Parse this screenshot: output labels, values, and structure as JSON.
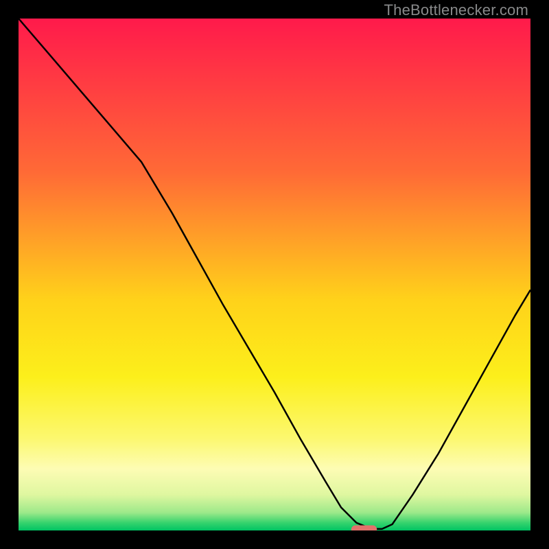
{
  "watermark": "TheBottlenecker.com",
  "chart_data": {
    "type": "line",
    "title": "",
    "xlabel": "",
    "ylabel": "",
    "xlim": [
      0,
      100
    ],
    "ylim": [
      0,
      100
    ],
    "grid": false,
    "legend": false,
    "gradient_stops": [
      {
        "offset": 0,
        "color": "#ff1a4b"
      },
      {
        "offset": 0.3,
        "color": "#ff6a36"
      },
      {
        "offset": 0.55,
        "color": "#ffd21a"
      },
      {
        "offset": 0.7,
        "color": "#fcef1b"
      },
      {
        "offset": 0.82,
        "color": "#fcf86f"
      },
      {
        "offset": 0.88,
        "color": "#fdfcb4"
      },
      {
        "offset": 0.93,
        "color": "#dff7a0"
      },
      {
        "offset": 0.965,
        "color": "#9de98a"
      },
      {
        "offset": 0.985,
        "color": "#36d36d"
      },
      {
        "offset": 1.0,
        "color": "#00c463"
      }
    ],
    "series": [
      {
        "name": "bottleneck-curve",
        "stroke": "#000000",
        "stroke_width": 2.5,
        "x": [
          0.0,
          6,
          12,
          18,
          24,
          30,
          35,
          40,
          45,
          50,
          55,
          60,
          63,
          66,
          69,
          71,
          73,
          77,
          82,
          87,
          92,
          97,
          100
        ],
        "y": [
          100,
          93,
          86,
          79,
          72,
          62,
          53,
          44,
          35.5,
          27,
          18,
          9.5,
          4.5,
          1.5,
          0.3,
          0.3,
          1.2,
          7,
          15,
          24,
          33,
          42,
          47
        ]
      }
    ],
    "marker": {
      "name": "optimal-point",
      "x": 67.5,
      "y": 0.2,
      "width_pct": 5.0,
      "height_pct": 1.6,
      "color": "#e2726b"
    }
  }
}
